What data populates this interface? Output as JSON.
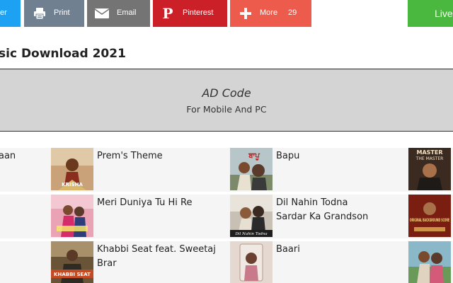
{
  "share": {
    "twitter_label": "er",
    "print_label": "Print",
    "email_label": "Email",
    "pinterest_label": "Pinterest",
    "more_label": "More",
    "more_count": "29",
    "live_label": "Live"
  },
  "page": {
    "title": "sic Download 2021"
  },
  "ad": {
    "title": "AD Code",
    "subtitle": "For Mobile And PC"
  },
  "songs": {
    "r1c0": "aan",
    "r1c1": "Prem's Theme",
    "r1c2": "Bapu",
    "r2c1": "Meri Duniya Tu Hi Re",
    "r2c2_line1": "Dil Nahin Todna",
    "r2c2_line2": "Sardar Ka Grandson",
    "r3c1_line1": "Khabbi Seat feat. Sweetaj",
    "r3c1_line2": "Brar",
    "r3c2": "Baari"
  },
  "thumb_text": {
    "prem_cover": "KRISHA",
    "bapu_cover": "ਬਾਪੂ",
    "master_cover_1": "MASTER",
    "master_cover_2": "THE MASTER",
    "dil_cover": "Dil Nahin Todna",
    "origin_cover": "ORIGINAL BACKGROUND SCORE",
    "khabbi_cover": "KHABBI SEAT"
  },
  "colors": {
    "twitter": "#1da1f2",
    "print": "#708090",
    "email": "#747474",
    "pinterest": "#cb2027",
    "more": "#ec5b4c",
    "live": "#4ab83f",
    "ad_bg": "#d4d4d4"
  },
  "icons": {
    "print": "printer-icon",
    "email": "envelope-icon",
    "pinterest": "pinterest-icon",
    "more": "plus-icon"
  }
}
